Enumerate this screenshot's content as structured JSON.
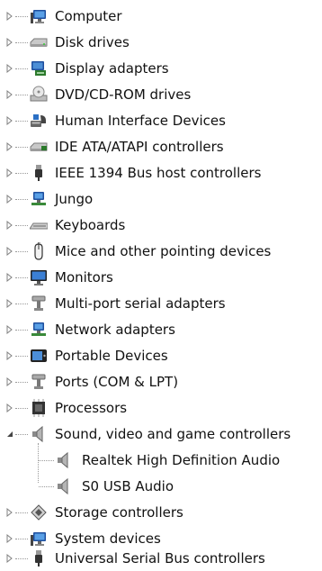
{
  "tree": {
    "items": [
      {
        "label": "Computer",
        "icon": "computer-icon",
        "expanded": false
      },
      {
        "label": "Disk drives",
        "icon": "disk-drive-icon",
        "expanded": false
      },
      {
        "label": "Display adapters",
        "icon": "display-adapter-icon",
        "expanded": false
      },
      {
        "label": "DVD/CD-ROM drives",
        "icon": "dvd-drive-icon",
        "expanded": false
      },
      {
        "label": "Human Interface Devices",
        "icon": "hid-icon",
        "expanded": false
      },
      {
        "label": "IDE ATA/ATAPI controllers",
        "icon": "ide-controller-icon",
        "expanded": false
      },
      {
        "label": "IEEE 1394 Bus host controllers",
        "icon": "firewire-icon",
        "expanded": false
      },
      {
        "label": "Jungo",
        "icon": "network-computer-icon",
        "expanded": false
      },
      {
        "label": "Keyboards",
        "icon": "keyboard-icon",
        "expanded": false
      },
      {
        "label": "Mice and other pointing devices",
        "icon": "mouse-icon",
        "expanded": false
      },
      {
        "label": "Monitors",
        "icon": "monitor-icon",
        "expanded": false
      },
      {
        "label": "Multi-port serial adapters",
        "icon": "serial-port-icon",
        "expanded": false
      },
      {
        "label": "Network adapters",
        "icon": "network-adapter-icon",
        "expanded": false
      },
      {
        "label": "Portable Devices",
        "icon": "portable-device-icon",
        "expanded": false
      },
      {
        "label": "Ports (COM & LPT)",
        "icon": "port-icon",
        "expanded": false
      },
      {
        "label": "Processors",
        "icon": "processor-icon",
        "expanded": false
      },
      {
        "label": "Sound, video and game controllers",
        "icon": "speaker-icon",
        "expanded": true,
        "children": [
          {
            "label": "Realtek High Definition Audio",
            "icon": "speaker-icon"
          },
          {
            "label": "S0 USB Audio",
            "icon": "speaker-icon"
          }
        ]
      },
      {
        "label": "Storage controllers",
        "icon": "storage-controller-icon",
        "expanded": false
      },
      {
        "label": "System devices",
        "icon": "system-device-icon",
        "expanded": false
      },
      {
        "label": "Universal Serial Bus controllers",
        "icon": "usb-icon",
        "expanded": false
      }
    ]
  }
}
